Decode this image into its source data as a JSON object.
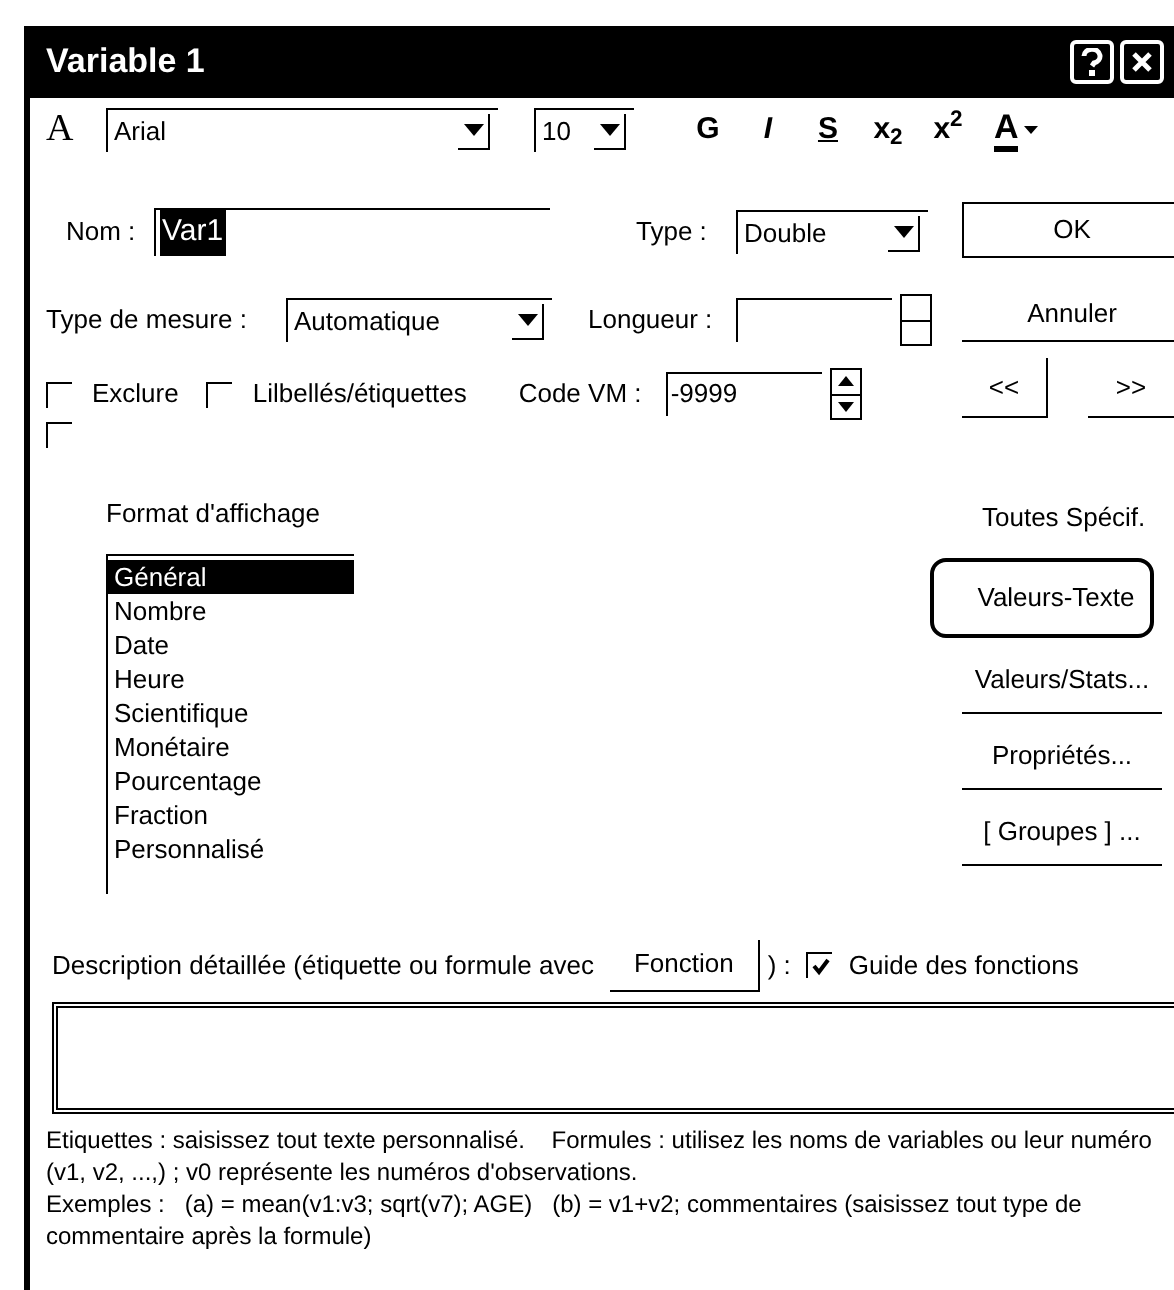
{
  "window": {
    "title": "Variable 1"
  },
  "toolbar": {
    "font_icon": "A",
    "font": "Arial",
    "size": "10",
    "format_buttons": [
      {
        "label": "G",
        "kind": "bold"
      },
      {
        "label": "I",
        "kind": "italic"
      },
      {
        "label": "S",
        "kind": "underline"
      },
      {
        "label": "x$_{2}$",
        "kind": "plain"
      },
      {
        "label": "x$^{2}$",
        "kind": "plain"
      }
    ],
    "color_button": "A"
  },
  "name": {
    "label": "Nom :",
    "value": "Var1"
  },
  "type": {
    "label": "Type :",
    "value": "Double"
  },
  "measure": {
    "label": "Type de mesure :",
    "value": "Automatique"
  },
  "length": {
    "label": "Longueur :"
  },
  "checks": [
    {
      "label": "Exclure",
      "checked": false
    },
    {
      "label": "Lilbellés/étiquettes",
      "checked": false
    }
  ],
  "extra_check": {
    "checked": false
  },
  "missing_code": {
    "label": "Code VM :",
    "value": "-9999"
  },
  "format": {
    "label": "Format d'affichage",
    "items": [
      {
        "label": "Général",
        "selected": true
      },
      {
        "label": "Nombre",
        "selected": false
      },
      {
        "label": "Date",
        "selected": false
      },
      {
        "label": "Heure",
        "selected": false
      },
      {
        "label": "Scientifique",
        "selected": false
      },
      {
        "label": "Monétaire",
        "selected": false
      },
      {
        "label": "Pourcentage",
        "selected": false
      },
      {
        "label": "Fraction",
        "selected": false
      },
      {
        "label": "Personnalisé",
        "selected": false
      }
    ]
  },
  "buttons": {
    "ok": "OK",
    "cancel": "Annuler",
    "prev": "<<",
    "next": ">>"
  },
  "specs": {
    "label": "Toutes Spécif.",
    "buttons": [
      {
        "label": "Valeurs-Texte",
        "focused": true
      },
      {
        "label": "Valeurs/Stats...",
        "focused": false
      },
      {
        "label": "Propriétés...",
        "focused": false
      },
      {
        "label": "[ Groupes ] ...",
        "focused": false
      }
    ]
  },
  "description": {
    "label": "Description détaillée (étiquette ou formule avec",
    "button": "Fonction",
    "after": ") :",
    "guide": {
      "label": "Guide des fonctions",
      "checked": true
    }
  },
  "help": [
    "Etiquettes : saisissez tout texte personnalisé.    Formules : utilisez les noms de variables ou leur numéro (v1, v2, ...,) ; v0 représente les numéros d'observations.",
    "Exemples :   (a) = mean(v1:v3; sqrt(v7); AGE)   (b) = v1+v2; commentaires (saisissez tout type de commentaire après la formule)"
  ]
}
